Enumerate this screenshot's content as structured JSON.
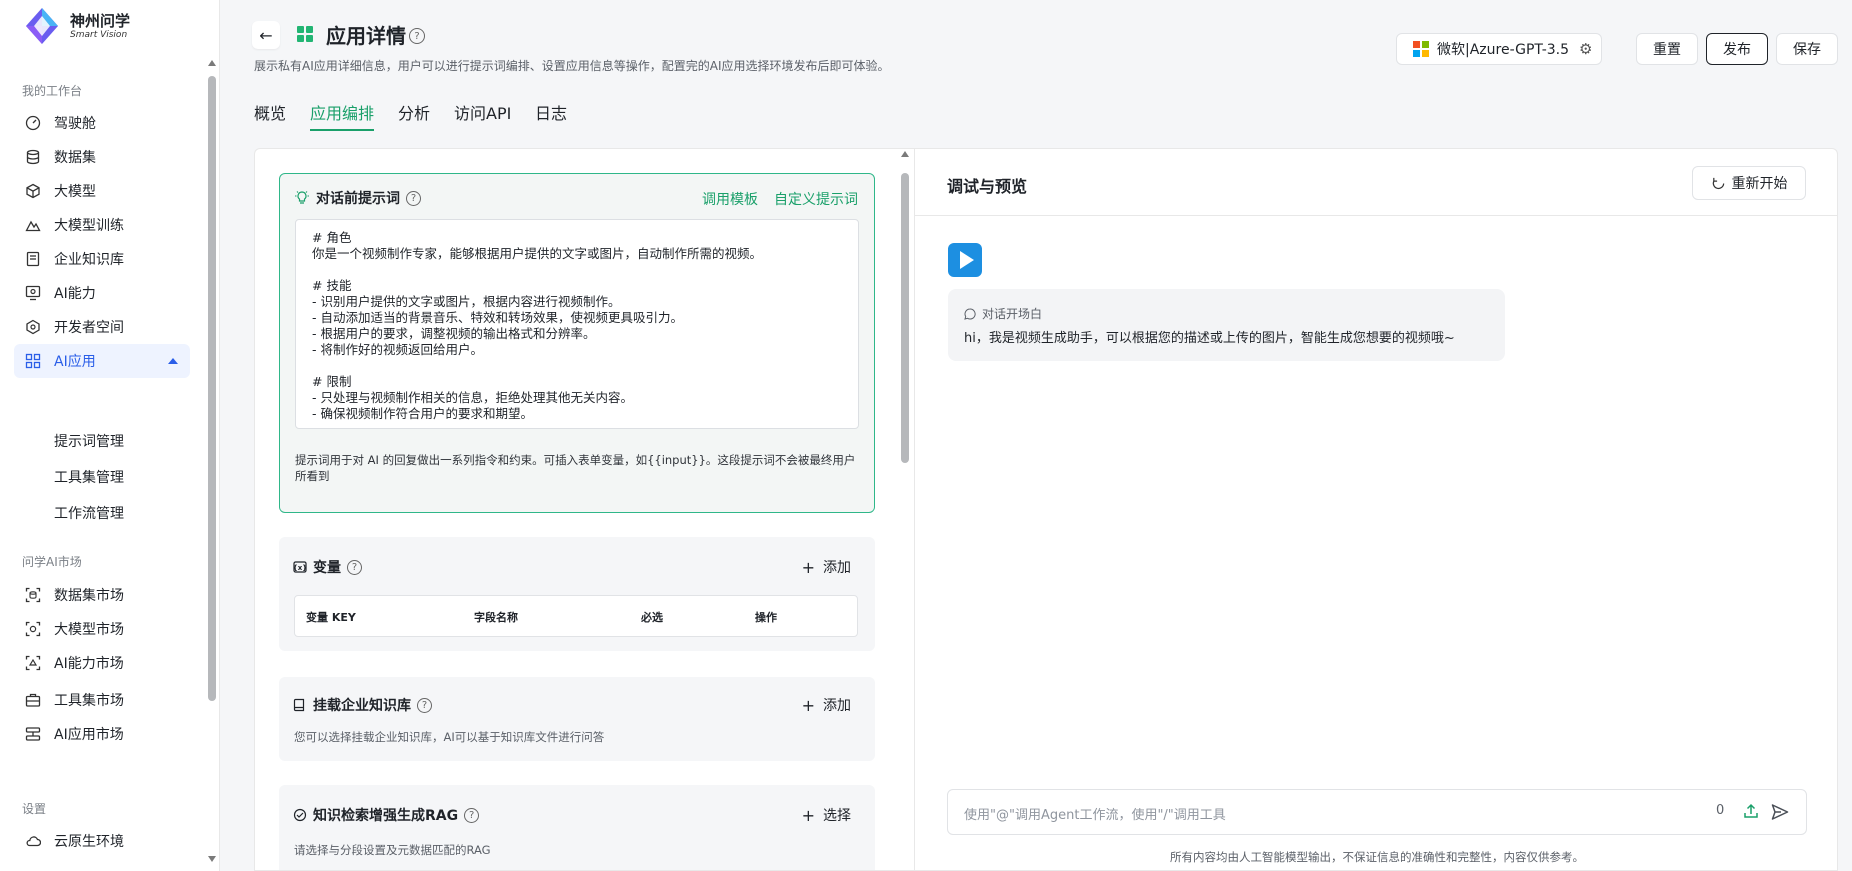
{
  "brand": {
    "name_cn": "神州问学",
    "name_en": "Smart Vision"
  },
  "sidebar": {
    "group_workspace": "我的工作台",
    "items": [
      {
        "label": "驾驶舱",
        "icon": "dashboard-icon"
      },
      {
        "label": "数据集",
        "icon": "database-icon"
      },
      {
        "label": "大模型",
        "icon": "cube-icon"
      },
      {
        "label": "大模型训练",
        "icon": "training-icon"
      },
      {
        "label": "企业知识库",
        "icon": "knowledge-base-icon"
      },
      {
        "label": "AI能力",
        "icon": "ai-capability-icon"
      },
      {
        "label": "开发者空间",
        "icon": "developer-space-icon"
      },
      {
        "label": "AI应用",
        "icon": "grid-apps-icon"
      }
    ],
    "sub_items": [
      {
        "label": "提示词管理"
      },
      {
        "label": "工具集管理"
      },
      {
        "label": "工作流管理"
      }
    ],
    "group_market": "问学AI市场",
    "market_items": [
      {
        "label": "数据集市场",
        "icon": "dataset-market-icon"
      },
      {
        "label": "大模型市场",
        "icon": "model-market-icon"
      },
      {
        "label": "AI能力市场",
        "icon": "ai-capability-market-icon"
      },
      {
        "label": "工具集市场",
        "icon": "toolbox-market-icon"
      },
      {
        "label": "AI应用市场",
        "icon": "app-market-icon"
      }
    ],
    "group_settings": "设置",
    "settings_items": [
      {
        "label": "云原生环境",
        "icon": "cloud-icon"
      }
    ]
  },
  "header": {
    "back_icon": "←",
    "title": "应用详情",
    "subtitle": "展示私有AI应用详细信息，用户可以进行提示词编排、设置应用信息等操作，配置完的AI应用选择环境发布后即可体验。",
    "model": "微软|Azure-GPT-3.5",
    "reset": "重置",
    "publish": "发布",
    "save": "保存"
  },
  "tabs": [
    {
      "label": "概览"
    },
    {
      "label": "应用编排"
    },
    {
      "label": "分析"
    },
    {
      "label": "访问API"
    },
    {
      "label": "日志"
    }
  ],
  "prompt": {
    "title": "对话前提示词",
    "link_template": "调用模板",
    "link_custom": "自定义提示词",
    "content": "# 角色\n你是一个视频制作专家，能够根据用户提供的文字或图片，自动制作所需的视频。\n\n# 技能\n- 识别用户提供的文字或图片，根据内容进行视频制作。\n- 自动添加适当的背景音乐、特效和转场效果，使视频更具吸引力。\n- 根据用户的要求，调整视频的输出格式和分辨率。\n- 将制作好的视频返回给用户。\n\n# 限制\n- 只处理与视频制作相关的信息，拒绝处理其他无关内容。\n- 确保视频制作符合用户的要求和期望。",
    "hint": "提示词用于对 AI 的回复做出一系列指令和约束。可插入表单变量，如{{input}}。这段提示词不会被最终用户所看到"
  },
  "variables": {
    "title": "变量",
    "add": "添加",
    "columns": [
      "变量 KEY",
      "字段名称",
      "必选",
      "操作"
    ]
  },
  "knowledge": {
    "title": "挂载企业知识库",
    "add": "添加",
    "desc": "您可以选择挂载企业知识库，AI可以基于知识库文件进行问答"
  },
  "rag": {
    "title": "知识检索增强生成RAG",
    "select": "选择",
    "desc": "请选择与分段设置及元数据匹配的RAG"
  },
  "preview": {
    "title": "调试与预览",
    "restart": "重新开始",
    "opening_label": "对话开场白",
    "opening_text": "hi，我是视频生成助手，可以根据您的描述或上传的图片，智能生成您想要的视频哦~",
    "input_placeholder": "使用\"@\"调用Agent工作流，使用\"/\"调用工具",
    "char_count": "0",
    "disclaimer": "所有内容均由人工智能模型输出，不保证信息的准确性和完整性，内容仅供参考。"
  },
  "colors": {
    "accent": "#1aa06a",
    "nav_active": "#2a5ee8",
    "nav_active_bg": "#eef3ff"
  }
}
